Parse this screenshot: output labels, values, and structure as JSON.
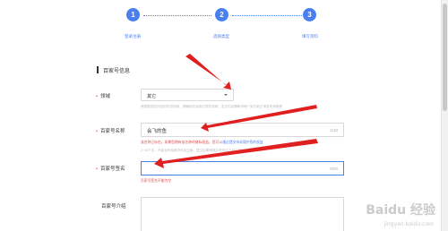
{
  "steps": [
    {
      "number": "1",
      "label": "登录注册"
    },
    {
      "number": "2",
      "label": "选择类型"
    },
    {
      "number": "3",
      "label": "填写资料"
    }
  ],
  "section": {
    "title": "百家号信息"
  },
  "domain_field": {
    "label": "领域",
    "value": "其它",
    "hint": "请根据您的作品的内容领域，明确地告诉我们您的领域，发文内容需和领域一致方能正常发布和推荐"
  },
  "name_field": {
    "label": "百家号名称",
    "value": "会飞的鱼",
    "count": "4/10",
    "error": "该名称已存在，如果您拥有该名称的商标权益，您可以",
    "error_link": "通过提交申诉保护您的权益",
    "hint": "2~10个字，不能含有特殊符号及空格，提交后需审核并完成后方可生效"
  },
  "signature_field": {
    "label": "百家号签名",
    "value": "",
    "count": "0/20",
    "error": "百家号签名不能为空"
  },
  "intro_field": {
    "label": "百家号介绍"
  },
  "watermark": {
    "text": "Baidu 经验",
    "sub": "jingyan.baidu.com"
  },
  "colors": {
    "accent": "#4a7ff0",
    "error": "#e24a4a",
    "arrow": "#e02020"
  }
}
